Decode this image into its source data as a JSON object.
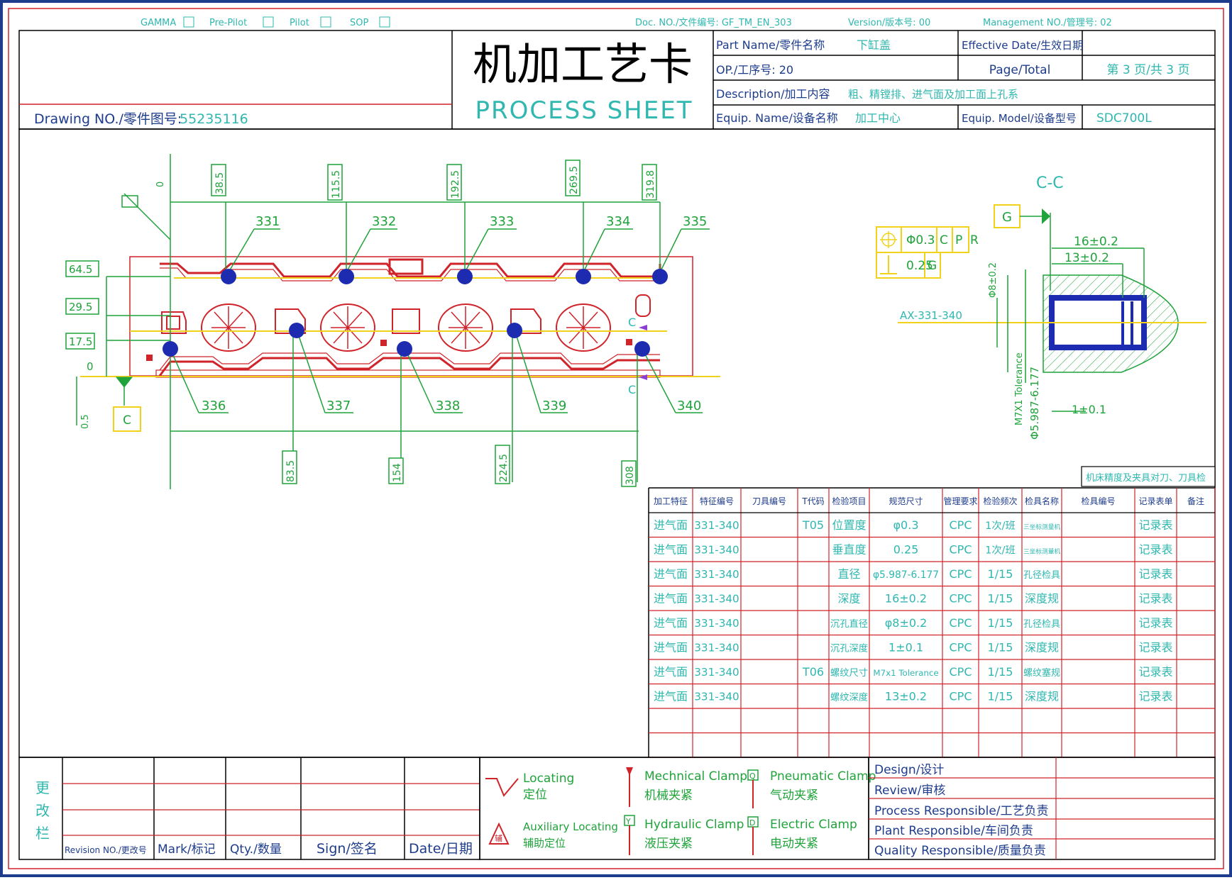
{
  "header_status": {
    "labels": [
      "GAMMA",
      "Pre-Pilot",
      "Pilot",
      "SOP"
    ],
    "doc_no": "Doc. NO./文件编号: GF_TM_EN_303",
    "version": "Version/版本号: 00",
    "management_no": "Management NO./管理号: 02"
  },
  "title_block": {
    "drawing_no_label": "Drawing NO./零件图号:",
    "drawing_no_value": "55235116",
    "title_cn": "机加工艺卡",
    "title_en": "PROCESS SHEET",
    "part_name_label": "Part Name/零件名称",
    "part_name_value": "下缸盖",
    "effective_date_label": "Effective Date/生效日期",
    "effective_date_value": "",
    "op_no_label": "OP./工序号: 20",
    "page_total_label": "Page/Total",
    "page_total_value": "第 3 页/共 3 页",
    "description_label": "Description/加工内容",
    "description_value": "粗、精镗排、进气面及加工面上孔系",
    "equip_name_label": "Equip. Name/设备名称",
    "equip_name_value": "加工中心",
    "equip_model_label": "Equip. Model/设备型号",
    "equip_model_value": "SDC700L"
  },
  "drawing": {
    "top_dims": [
      "38.5",
      "115.5",
      "192.5",
      "269.5",
      "319.8"
    ],
    "top_balloons": [
      "331",
      "332",
      "333",
      "334",
      "335"
    ],
    "bottom_balloons": [
      "336",
      "337",
      "338",
      "339",
      "340"
    ],
    "bottom_dims": [
      "83.5",
      "154",
      "224.5",
      "308"
    ],
    "left_dims": [
      "64.5",
      "29.5",
      "17.5",
      "0"
    ],
    "datum_0_top": "0",
    "datum_c": "C",
    "datum_side": "0.5",
    "section_label": "C-C",
    "datum_g": "G",
    "fcf_row1": [
      "Φ0.3",
      "C",
      "P",
      "R"
    ],
    "fcf_row2": [
      "0.25",
      "G"
    ],
    "dim_16": "16±0.2",
    "dim_13": "13±0.2",
    "dim_phi8": "Φ8±0.2",
    "axis_label": "AX-331-340",
    "dim_thread": "M7X1 Tolerance",
    "dim_phi5": "Φ5.987-6.177",
    "dim_1": "1±0.1",
    "section_mark": "C"
  },
  "inspection": {
    "note": "机床精度及夹具对刀、刀具检",
    "headers": [
      "加工特征",
      "特征编号",
      "刀具编号",
      "T代码",
      "检验项目",
      "规范尺寸",
      "管理要求",
      "检验频次",
      "检具名称",
      "检具编号",
      "记录表单",
      "备注"
    ],
    "rows": [
      [
        "进气面",
        "331-340",
        "",
        "T05",
        "位置度",
        "φ0.3",
        "CPC",
        "1次/班",
        "三坐标测量机",
        "",
        "记录表",
        ""
      ],
      [
        "进气面",
        "331-340",
        "",
        "",
        "垂直度",
        "0.25",
        "CPC",
        "1次/班",
        "三坐标测量机",
        "",
        "记录表",
        ""
      ],
      [
        "进气面",
        "331-340",
        "",
        "",
        "直径",
        "φ5.987-6.177",
        "CPC",
        "1/15",
        "孔径检具",
        "",
        "记录表",
        ""
      ],
      [
        "进气面",
        "331-340",
        "",
        "",
        "深度",
        "16±0.2",
        "CPC",
        "1/15",
        "深度规",
        "",
        "记录表",
        ""
      ],
      [
        "进气面",
        "331-340",
        "",
        "",
        "沉孔直径",
        "φ8±0.2",
        "CPC",
        "1/15",
        "孔径检具",
        "",
        "记录表",
        ""
      ],
      [
        "进气面",
        "331-340",
        "",
        "",
        "沉孔深度",
        "1±0.1",
        "CPC",
        "1/15",
        "深度规",
        "",
        "记录表",
        ""
      ],
      [
        "进气面",
        "331-340",
        "",
        "T06",
        "螺纹尺寸",
        "M7x1 Tolerance",
        "CPC",
        "1/15",
        "螺纹塞规",
        "",
        "记录表",
        ""
      ],
      [
        "进气面",
        "331-340",
        "",
        "",
        "螺纹深度",
        "13±0.2",
        "CPC",
        "1/15",
        "深度规",
        "",
        "记录表",
        ""
      ],
      [
        "",
        "",
        "",
        "",
        "",
        "",
        "",
        "",
        "",
        "",
        "",
        ""
      ],
      [
        "",
        "",
        "",
        "",
        "",
        "",
        "",
        "",
        "",
        "",
        "",
        ""
      ]
    ]
  },
  "revision": {
    "side_label": [
      "更",
      "改",
      "栏"
    ],
    "headers": [
      "Revision NO./更改号",
      "Mark/标记",
      "Qty./数量",
      "Sign/签名",
      "Date/日期"
    ]
  },
  "legend": {
    "locating": "Locating",
    "locating_cn": "定位",
    "aux_locating": "Auxiliary Locating",
    "aux_locating_cn": "辅助定位",
    "mech_clamp": "Mechnical Clamp",
    "mech_clamp_cn": "机械夹紧",
    "hyd_clamp": "Hydraulic Clamp",
    "hyd_clamp_cn": "液压夹紧",
    "pneu_clamp": "Pneumatic Clamp",
    "pneu_clamp_cn": "气动夹紧",
    "elec_clamp": "Electric Clamp",
    "elec_clamp_cn": "电动夹紧",
    "q_symbol": "Q",
    "y_symbol": "Y",
    "d_symbol": "D",
    "aux_symbol": "辅"
  },
  "signoff": {
    "design": "Design/设计",
    "review": "Review/审核",
    "process": "Process Responsible/工艺负责",
    "plant": "Plant Responsible/车间负责",
    "quality": "Quality Responsible/质量负责"
  },
  "colors": {
    "frame": "#1e3c8c",
    "red": "#d0232a",
    "green": "#1fa33a",
    "yellow": "#f0d21a",
    "blue": "#1d2bb0",
    "cyan": "#2fb7b0",
    "purple": "#8a3fd0"
  }
}
